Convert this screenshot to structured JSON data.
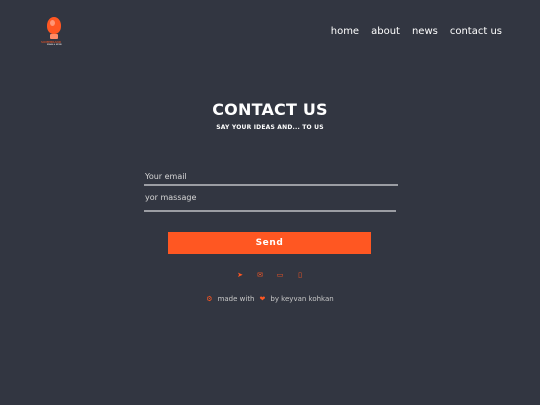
{
  "logo": {
    "brand": "SOMEBRAND",
    "tagline": "IDEAS & MORE"
  },
  "nav": {
    "items": [
      "home",
      "about",
      "news",
      "contact us"
    ]
  },
  "contact": {
    "title": "CONTACT US",
    "subtitle": "SAY YOUR IDEAS AND... TO US",
    "email_placeholder": "Your email",
    "message_placeholder": "yor massage",
    "send_label": "Send"
  },
  "socials": [
    {
      "icon": "telegram-icon",
      "glyph": "➤"
    },
    {
      "icon": "email-icon",
      "glyph": "✉"
    },
    {
      "icon": "laptop-icon",
      "glyph": "▭"
    },
    {
      "icon": "phone-icon",
      "glyph": "▯"
    }
  ],
  "footer": {
    "icon_glyph": "⚙",
    "made_with": "made with",
    "heart_glyph": "❤",
    "by": "by keyvan kohkan"
  },
  "colors": {
    "background": "#323641",
    "accent": "#ff5722",
    "text": "#ffffff"
  }
}
